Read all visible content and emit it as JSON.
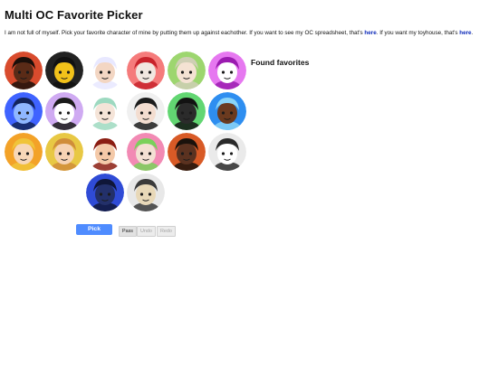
{
  "page": {
    "title": "Multi OC Favorite Picker",
    "intro_text": "I am not full of myself. Pick your favorite character of mine by putting them up against eachother. If you want to see my OC spreadsheet, that's ",
    "link1_label": "here",
    "intro_middle": ". If you want my toyhouse, that's ",
    "link2_label": "here",
    "intro_end": "."
  },
  "found_favorites": {
    "heading": "Found favorites"
  },
  "buttons": {
    "pick_label": "Pick",
    "pass_label": "Pass",
    "undo_label": "Undo",
    "redo_label": "Redo"
  },
  "characters": [
    {
      "bg": "#d84b2d",
      "face": "#5a2b17",
      "hair": "#1a0f0a",
      "icon": "oc-dark-skin-red-bg"
    },
    {
      "bg": "#222222",
      "face": "#f2c21a",
      "hair": "#111111",
      "icon": "oc-yellow-mask"
    },
    {
      "bg": "#ffffff",
      "face": "#f3d6c3",
      "hair": "#e8e8ff",
      "icon": "oc-white-hair-magenta"
    },
    {
      "bg": "#f57b7b",
      "face": "#f1e7e0",
      "hair": "#c8232b",
      "icon": "oc-red-hair"
    },
    {
      "bg": "#9dd66f",
      "face": "#f4e2d3",
      "hair": "#cfcfb5",
      "icon": "oc-blond-green-bg"
    },
    {
      "bg": "#e678f0",
      "face": "#ffffff",
      "hair": "#9b1bb0",
      "icon": "oc-purple-hair"
    },
    {
      "bg": "#3f63ff",
      "face": "#8fb7ff",
      "hair": "#13245a",
      "icon": "oc-blue-figure"
    },
    {
      "bg": "#cfaaf2",
      "face": "#ffffff",
      "hair": "#1a1a1a",
      "icon": "oc-white-silhouette"
    },
    {
      "bg": "#ffffff",
      "face": "#f5e4d8",
      "hair": "#9dd9c0",
      "icon": "oc-mint-hair"
    },
    {
      "bg": "#f0f0f0",
      "face": "#f3ddd0",
      "hair": "#1c1c1c",
      "icon": "oc-black-white-hair"
    },
    {
      "bg": "#62d672",
      "face": "#2b2b2b",
      "hair": "#121212",
      "icon": "oc-green-bg-dark"
    },
    {
      "bg": "#2e8ef0",
      "face": "#6b3a1f",
      "hair": "#8ad4f7",
      "icon": "oc-blue-hair"
    },
    {
      "bg": "#f3a228",
      "face": "#f7d7b8",
      "hair": "#f0c43a",
      "icon": "oc-spiky-blond"
    },
    {
      "bg": "#e8c844",
      "face": "#f6d3b4",
      "hair": "#d08d3a",
      "icon": "oc-ginger-hair"
    },
    {
      "bg": "#ffffff",
      "face": "#f4c9a8",
      "hair": "#8b1d12",
      "icon": "oc-red-hood"
    },
    {
      "bg": "#f28ab4",
      "face": "#f3e0d3",
      "hair": "#7ad15b",
      "icon": "oc-green-hair-pink-bg"
    },
    {
      "bg": "#d85a26",
      "face": "#5b3220",
      "hair": "#1a120c",
      "icon": "oc-orange-bg-dark-skin"
    },
    {
      "bg": "#eaeaea",
      "face": "#ffffff",
      "hair": "#2a2a2a",
      "icon": "oc-white-creature"
    },
    {
      "bg": "#2f4bd6",
      "face": "#23306a",
      "hair": "#0f1638",
      "icon": "oc-blue-crown"
    },
    {
      "bg": "#e8e8e8",
      "face": "#e8d8b8",
      "hair": "#3a3a3a",
      "icon": "oc-gray-robot"
    }
  ]
}
